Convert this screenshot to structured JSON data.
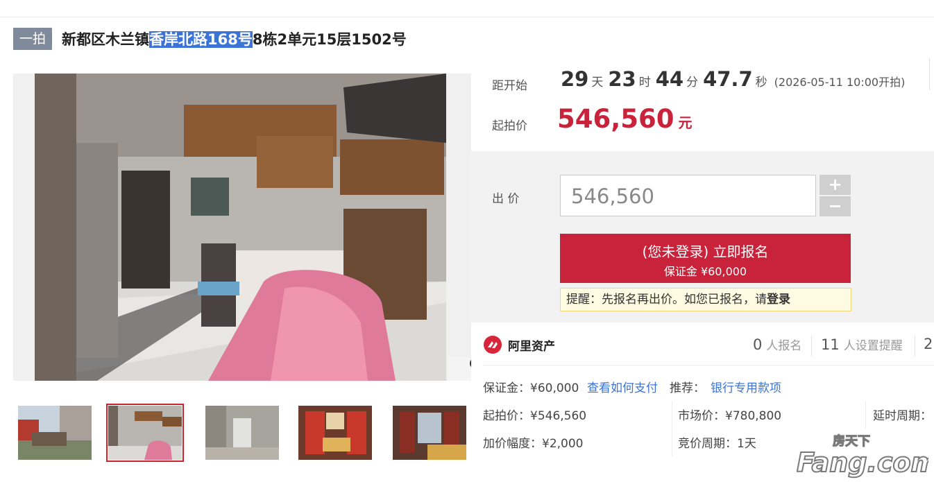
{
  "title": {
    "badge": "一拍",
    "prefix": "新都区木兰镇",
    "highlight": "香岸北路168号",
    "suffix": "8栋2单元15层1502号"
  },
  "countdown": {
    "label": "距开始",
    "days": "29",
    "days_unit": "天",
    "hours": "23",
    "hours_unit": "时",
    "minutes": "44",
    "minutes_unit": "分",
    "seconds": "47.7",
    "seconds_unit": "秒",
    "start_note": "(2026-05-11 10:00开拍)"
  },
  "start_price": {
    "label": "起拍价",
    "value": "546,560",
    "currency": "元"
  },
  "bid": {
    "label": "出 价",
    "input_value": "546,560",
    "plus": "+",
    "minus": "−",
    "register_line1": "(您未登录) 立即报名",
    "register_line2": "保证金 ¥60,000",
    "tip_text": "提醒：先报名再出价。如您已报名，请",
    "tip_link": "登录"
  },
  "ali": {
    "name": "阿里资产",
    "registered_count": "0",
    "registered_label": "人报名",
    "reminder_count": "11",
    "reminder_label": "人设置提醒",
    "third_count": "2"
  },
  "details": {
    "deposit": "保证金：¥60,000",
    "how_to_pay": "查看如何支付",
    "recommend_label": "推荐：",
    "recommend_link": "银行专用款项",
    "start_price": "起拍价：¥546,560",
    "market_price": "市场价：¥780,800",
    "delay_period": "延时周期：",
    "increment": "加价幅度：¥2,000",
    "auction_period": "竞价周期：1天"
  },
  "watermark": {
    "top": "房天下",
    "main": "Fang.com"
  },
  "colors": {
    "accent_red": "#c8233a",
    "link_blue": "#3b74d6",
    "badge_gray": "#7f8a9b"
  }
}
